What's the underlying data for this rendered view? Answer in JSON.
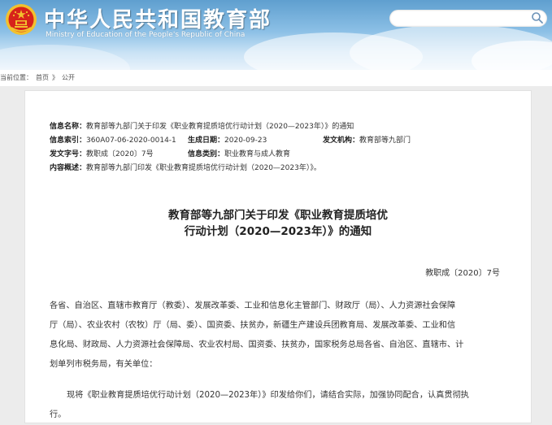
{
  "header": {
    "site_name": "中华人民共和国教育部",
    "site_name_en": "Ministry of Education of the People's Republic of China",
    "search_placeholder": "",
    "colors": {
      "header_top": "#5f9fcf",
      "header_bottom": "#e8f2fb",
      "emblem_red": "#d7231b",
      "emblem_gold": "#f2c12e"
    }
  },
  "breadcrumb": {
    "prefix": "当前位置：",
    "items": [
      "首页",
      "公开"
    ],
    "separator": "》"
  },
  "meta": {
    "name_label": "信息名称：",
    "name_value": "教育部等九部门关于印发《职业教育提质培优行动计划（2020—2023年）》的通知",
    "index_label": "信息索引：",
    "index_value": "360A07-06-2020-0014-1",
    "date_label": "生成日期：",
    "date_value": "2020-09-23",
    "org_label": "发文机构：",
    "org_value": "教育部等九部门",
    "docno_label": "发文字号：",
    "docno_value": "教职成〔2020〕7号",
    "category_label": "信息类别：",
    "category_value": "职业教育与成人教育",
    "summary_label": "内容概述：",
    "summary_value": "教育部等九部门印发《职业教育提质培优行动计划（2020—2023年）》。"
  },
  "article": {
    "title_line1": "教育部等九部门关于印发《职业教育提质培优",
    "title_line2": "行动计划（2020—2023年）》的通知",
    "doc_number": "教职成〔2020〕7号",
    "para1_line1": "各省、自治区、直辖市教育厅（教委）、发展改革委、工业和信息化主管部门、财政厅（局）、人力资源社会保障",
    "para1_line2": "厅（局）、农业农村（农牧）厅（局、委）、国资委、扶贫办，新疆生产建设兵团教育局、发展改革委、工业和信",
    "para1_line3": "息化局、财政局、人力资源社会保障局、农业农村局、国资委、扶贫办，国家税务总局各省、自治区、直辖市、计",
    "para1_line4": "划单列市税务局，有关单位：",
    "para2_line1": "现将《职业教育提质培优行动计划（2020—2023年）》印发给你们，请结合实际，加强协同配合，认真贯彻执",
    "para2_line2": "行。"
  }
}
